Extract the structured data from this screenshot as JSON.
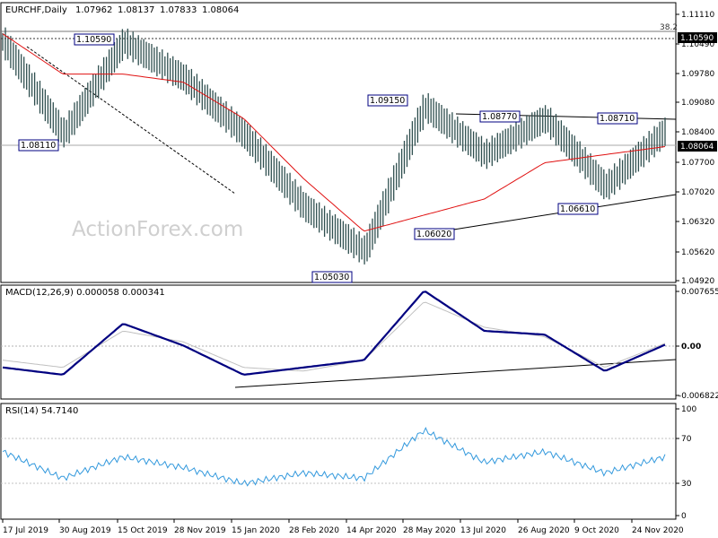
{
  "main": {
    "symbol": "EURCHF,Daily",
    "ohlc": [
      "1.07962",
      "1.08137",
      "1.07833",
      "1.08064"
    ],
    "watermark": "ActionForex.com",
    "fib_label": "38.2",
    "current_price": "1.08064",
    "level_price": "1.10590",
    "price_ticks": [
      "1.11110",
      "1.10490",
      "1.09780",
      "1.09080",
      "1.08400",
      "1.07700",
      "1.07020",
      "1.06320",
      "1.05620",
      "1.04920"
    ],
    "callouts": [
      "1.10590",
      "1.08110",
      "1.09150",
      "1.05030",
      "1.06020",
      "1.08770",
      "1.08710",
      "1.06610"
    ]
  },
  "macd": {
    "label": "MACD(12,26,9) 0.000058 0.000341",
    "ticks": [
      "0.007655",
      "0.00",
      "-0.006822"
    ]
  },
  "rsi": {
    "label": "RSI(14) 54.7140",
    "ticks": [
      "100",
      "70",
      "30",
      "0"
    ]
  },
  "dates": [
    "17 Jul 2019",
    "30 Aug 2019",
    "15 Oct 2019",
    "28 Nov 2019",
    "15 Jan 2020",
    "28 Feb 2020",
    "14 Apr 2020",
    "28 May 2020",
    "13 Jul 2020",
    "26 Aug 2020",
    "9 Oct 2020",
    "24 Nov 2020"
  ],
  "colors": {
    "bars": "#2f4f4f",
    "ma": "#e01010",
    "macd": "#000080",
    "signal": "#c0c0c0",
    "rsi": "#3399dd",
    "grid": "#c0c0c0",
    "axis": "#000000"
  },
  "chart_data": [
    {
      "type": "line",
      "title": "EURCHF,Daily",
      "ylim": [
        1.0455,
        1.1145
      ],
      "x": [
        "17 Jul 2019",
        "30 Aug 2019",
        "15 Oct 2019",
        "28 Nov 2019",
        "15 Jan 2020",
        "28 Feb 2020",
        "14 Apr 2020",
        "28 May 2020",
        "13 Jul 2020",
        "26 Aug 2020",
        "9 Oct 2020",
        "24 Nov 2020"
      ],
      "series": [
        {
          "values": [
            1.105,
            1.082,
            1.105,
            1.096,
            1.082,
            1.064,
            1.053,
            1.089,
            1.077,
            1.086,
            1.069,
            1.083
          ]
        }
      ],
      "extra_series": [
        {
          "values": [
            1.107,
            1.097,
            1.097,
            1.095,
            1.086,
            1.071,
            1.058,
            1.062,
            1.066,
            1.075,
            1.077,
            1.079
          ]
        }
      ],
      "annotations": [
        {
          "label": "1.10590",
          "value": 1.1059,
          "x": "15 Oct 2019"
        },
        {
          "label": "1.08110",
          "value": 1.0811,
          "x": "30 Aug 2019"
        },
        {
          "label": "1.09150",
          "value": 1.0915,
          "x": "28 May 2020"
        },
        {
          "label": "1.05030",
          "value": 1.0503,
          "x": "14 Apr 2020"
        },
        {
          "label": "1.06020",
          "value": 1.0602,
          "x": "13 Jul 2020"
        },
        {
          "label": "1.08770",
          "value": 1.0877,
          "x": "26 Aug 2020"
        },
        {
          "label": "1.08710",
          "value": 1.0871,
          "x": "24 Nov 2020"
        },
        {
          "label": "1.06610",
          "value": 1.0661,
          "x": "9 Oct 2020"
        }
      ],
      "grid": false
    },
    {
      "type": "line",
      "title": "MACD(12,26,9) 0.000058 0.000341",
      "ylim": [
        -0.0072,
        0.0079
      ],
      "x": [
        "17 Jul 2019",
        "30 Aug 2019",
        "15 Oct 2019",
        "28 Nov 2019",
        "15 Jan 2020",
        "28 Feb 2020",
        "14 Apr 2020",
        "28 May 2020",
        "13 Jul 2020",
        "26 Aug 2020",
        "9 Oct 2020",
        "24 Nov 2020"
      ],
      "series": [
        {
          "values": [
            -0.003,
            -0.004,
            0.003,
            0.0,
            -0.004,
            -0.003,
            -0.002,
            0.0075,
            0.002,
            0.0015,
            -0.0035,
            0.0001
          ]
        },
        {
          "values": [
            -0.002,
            -0.003,
            0.002,
            0.0005,
            -0.003,
            -0.0035,
            -0.002,
            0.006,
            0.0025,
            0.0012,
            -0.003,
            0.0003
          ]
        }
      ]
    },
    {
      "type": "line",
      "title": "RSI(14) 54.7140",
      "ylim": [
        0,
        100
      ],
      "x": [
        "17 Jul 2019",
        "30 Aug 2019",
        "15 Oct 2019",
        "28 Nov 2019",
        "15 Jan 2020",
        "28 Feb 2020",
        "14 Apr 2020",
        "28 May 2020",
        "13 Jul 2020",
        "26 Aug 2020",
        "9 Oct 2020",
        "24 Nov 2020"
      ],
      "series": [
        {
          "values": [
            60,
            35,
            55,
            45,
            30,
            40,
            35,
            80,
            50,
            60,
            40,
            55
          ]
        }
      ],
      "grid": true
    }
  ]
}
